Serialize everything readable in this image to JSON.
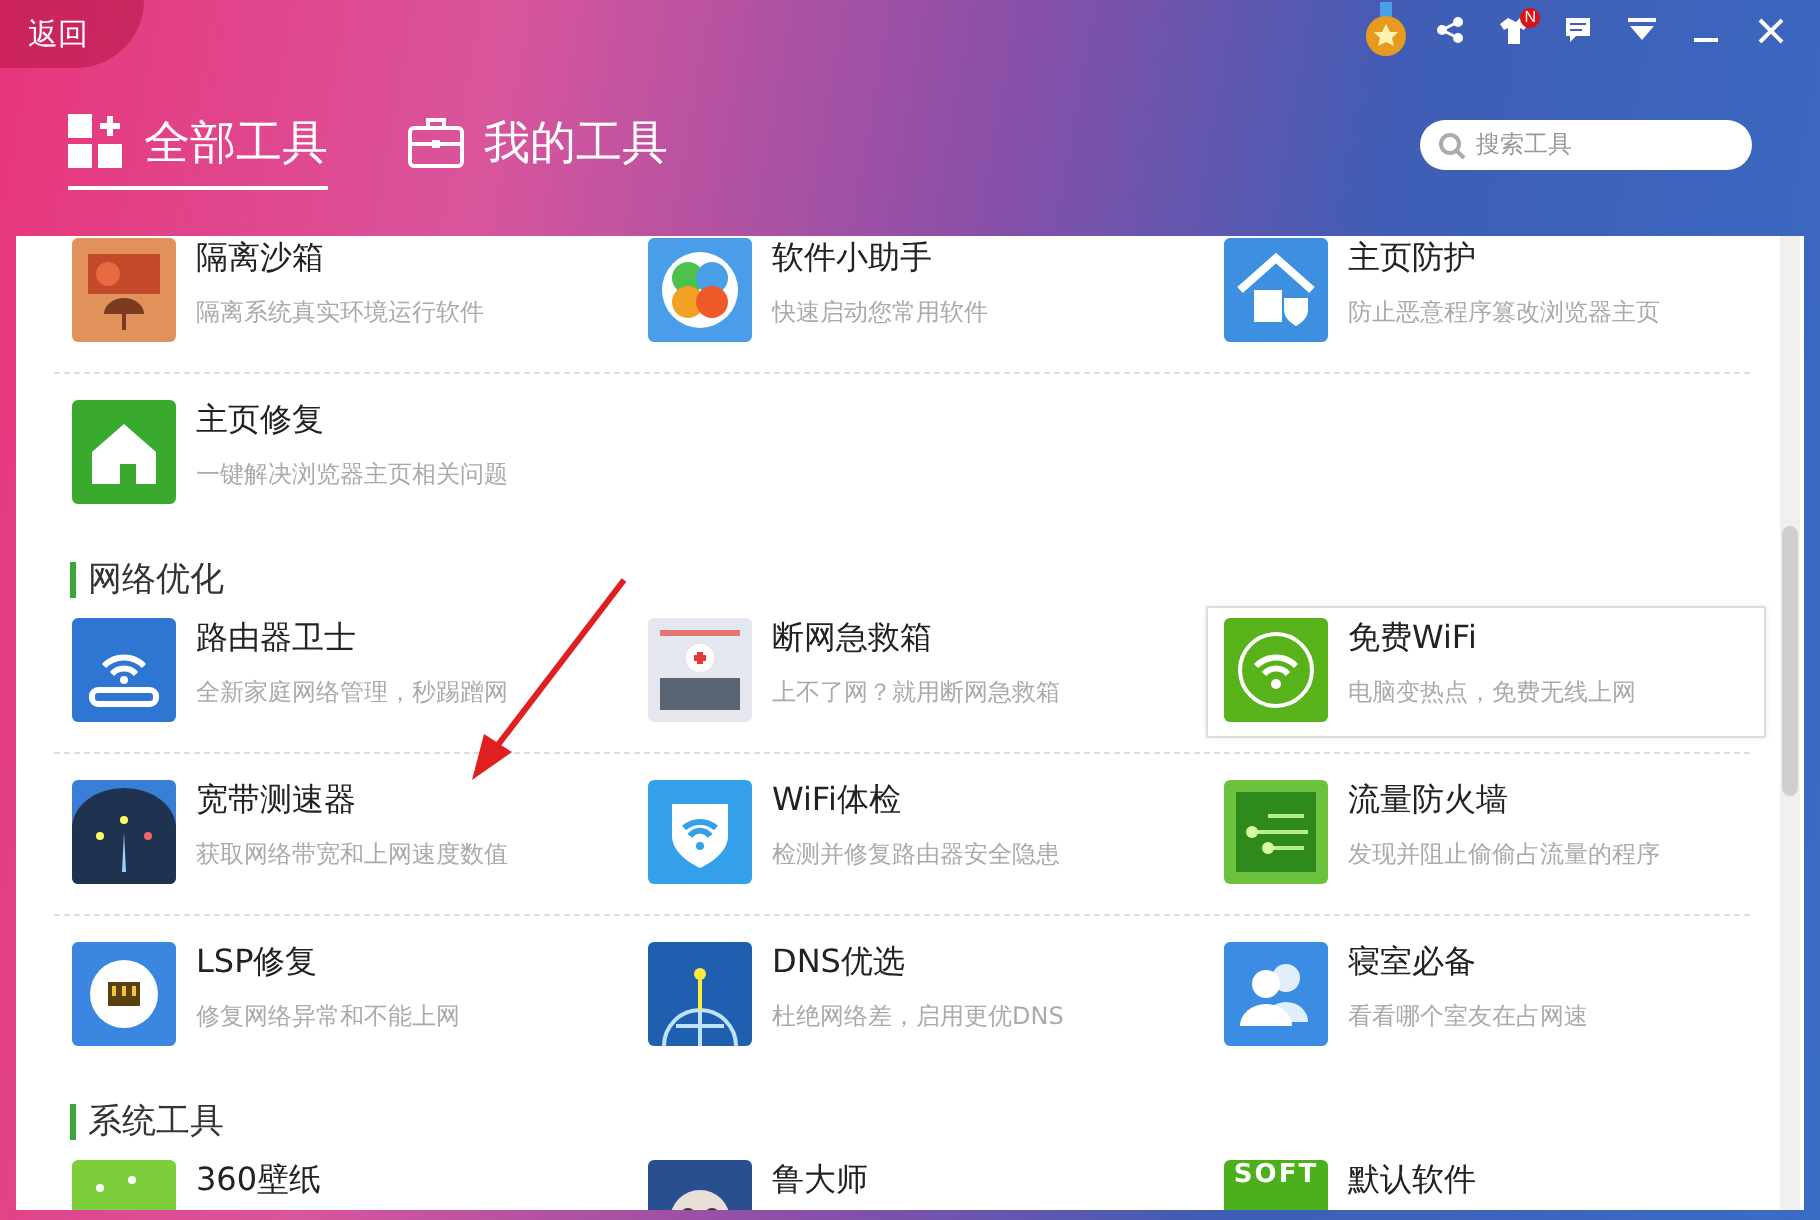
{
  "header": {
    "back": "返回",
    "tabs": [
      {
        "label": "全部工具",
        "selected": true
      },
      {
        "label": "我的工具",
        "selected": false
      }
    ],
    "search": {
      "placeholder": "搜索工具"
    },
    "shirt_badge": "N"
  },
  "sections": [
    {
      "rows": [
        [
          {
            "kind": "sandbox",
            "title": "隔离沙箱",
            "desc": "隔离系统真实环境运行软件",
            "highlighted": false
          },
          {
            "kind": "petals",
            "title": "软件小助手",
            "desc": "快速启动您常用软件",
            "highlighted": false
          },
          {
            "kind": "homeshield",
            "title": "主页防护",
            "desc": "防止恶意程序篡改浏览器主页",
            "highlighted": false
          }
        ],
        [
          {
            "kind": "home",
            "title": "主页修复",
            "desc": "一键解决浏览器主页相关问题",
            "highlighted": false
          }
        ]
      ]
    },
    {
      "title": "网络优化",
      "rows": [
        [
          {
            "kind": "router",
            "title": "路由器卫士",
            "desc": "全新家庭网络管理，秒踢蹭网",
            "highlighted": false
          },
          {
            "kind": "firstaid",
            "title": "断网急救箱",
            "desc": "上不了网？就用断网急救箱",
            "highlighted": false
          },
          {
            "kind": "wifi",
            "title": "免费WiFi",
            "desc": "电脑变热点，免费无线上网",
            "highlighted": true
          }
        ],
        [
          {
            "kind": "gauge",
            "title": "宽带测速器",
            "desc": "获取网络带宽和上网速度数值",
            "highlighted": false
          },
          {
            "kind": "wifishield",
            "title": "WiFi体检",
            "desc": "检测并修复路由器安全隐患",
            "highlighted": false
          },
          {
            "kind": "flow",
            "title": "流量防火墙",
            "desc": "发现并阻止偷偷占流量的程序",
            "highlighted": false
          }
        ],
        [
          {
            "kind": "port",
            "title": "LSP修复",
            "desc": "修复网络异常和不能上网",
            "highlighted": false
          },
          {
            "kind": "globe",
            "title": "DNS优选",
            "desc": "杜绝网络差，启用更优DNS",
            "highlighted": false
          },
          {
            "kind": "people",
            "title": "寝室必备",
            "desc": "看看哪个室友在占网速",
            "highlighted": false
          }
        ]
      ]
    },
    {
      "title": "系统工具",
      "rows": [
        [
          {
            "kind": "wallpaper",
            "title": "360壁纸",
            "highlighted": false
          },
          {
            "kind": "face",
            "title": "鲁大师",
            "highlighted": false
          },
          {
            "kind": "soft",
            "icon_text": "SOFT",
            "title": "默认软件",
            "highlighted": false
          }
        ]
      ]
    }
  ]
}
